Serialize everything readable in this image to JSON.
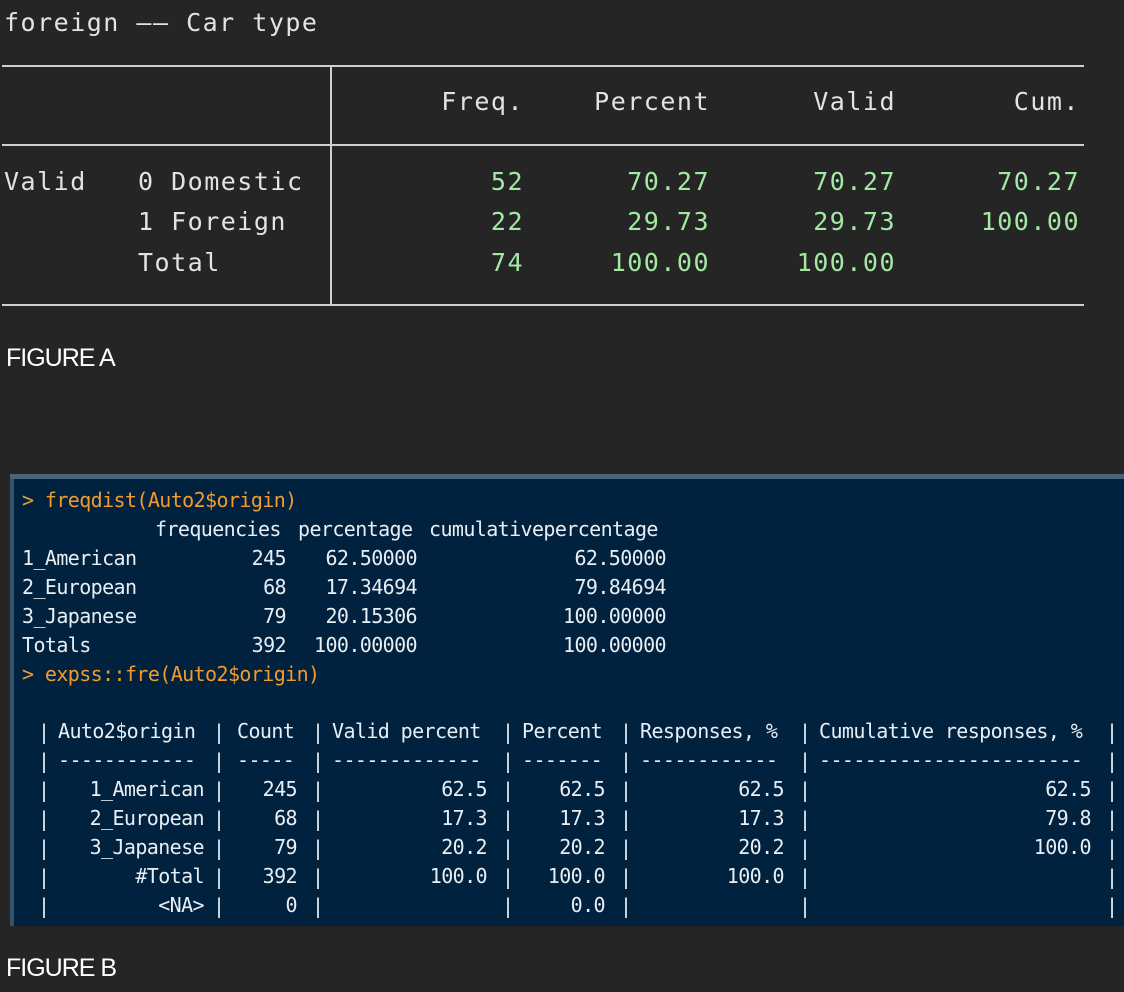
{
  "figure_a": {
    "title": "foreign —— Car type",
    "headers": [
      "Freq.",
      "Percent",
      "Valid",
      "Cum."
    ],
    "row_group_label": "Valid",
    "rows": [
      {
        "label": "0 Domestic",
        "freq": "52",
        "percent": "70.27",
        "valid": "70.27",
        "cum": "70.27"
      },
      {
        "label": "1 Foreign",
        "freq": "22",
        "percent": "29.73",
        "valid": "29.73",
        "cum": "100.00"
      },
      {
        "label": "Total",
        "freq": "74",
        "percent": "100.00",
        "valid": "100.00",
        "cum": ""
      }
    ],
    "caption": "FIGURE A",
    "value_color": "#a3e9a3"
  },
  "figure_b": {
    "cmd1": "> freqdist(Auto2$origin)",
    "freqdist_header": [
      "frequencies",
      "percentage",
      "cumulativepercentage"
    ],
    "freqdist_rows": [
      {
        "label": "1_American",
        "freq": "245",
        "pct": "62.50000",
        "cum": "62.50000"
      },
      {
        "label": "2_European",
        "freq": "68",
        "pct": "17.34694",
        "cum": "79.84694"
      },
      {
        "label": "3_Japanese",
        "freq": "79",
        "pct": "20.15306",
        "cum": "100.00000"
      },
      {
        "label": "Totals",
        "freq": "392",
        "pct": "100.00000",
        "cum": "100.00000"
      }
    ],
    "cmd2": "> expss::fre(Auto2$origin)",
    "fre_headers": [
      "Auto2$origin",
      "Count",
      "Valid percent",
      "Percent",
      "Responses, %",
      "Cumulative responses, %"
    ],
    "fre_dashes": [
      "------------",
      "-----",
      "-------------",
      "-------",
      "------------",
      "-----------------------"
    ],
    "fre_rows": [
      {
        "label": "1_American",
        "count": "245",
        "valid": "62.5",
        "pct": "62.5",
        "resp": "62.5",
        "cum": "62.5"
      },
      {
        "label": "2_European",
        "count": "68",
        "valid": "17.3",
        "pct": "17.3",
        "resp": "17.3",
        "cum": "79.8"
      },
      {
        "label": "3_Japanese",
        "count": "79",
        "valid": "20.2",
        "pct": "20.2",
        "resp": "20.2",
        "cum": "100.0"
      },
      {
        "label": "#Total",
        "count": "392",
        "valid": "100.0",
        "pct": "100.0",
        "resp": "100.0",
        "cum": ""
      },
      {
        "label": "<NA>",
        "count": "0",
        "valid": "",
        "pct": "0.0",
        "resp": "",
        "cum": ""
      }
    ],
    "caption": "FIGURE B",
    "console_bg": "#00223e",
    "prompt_color": "#f29a2e"
  }
}
